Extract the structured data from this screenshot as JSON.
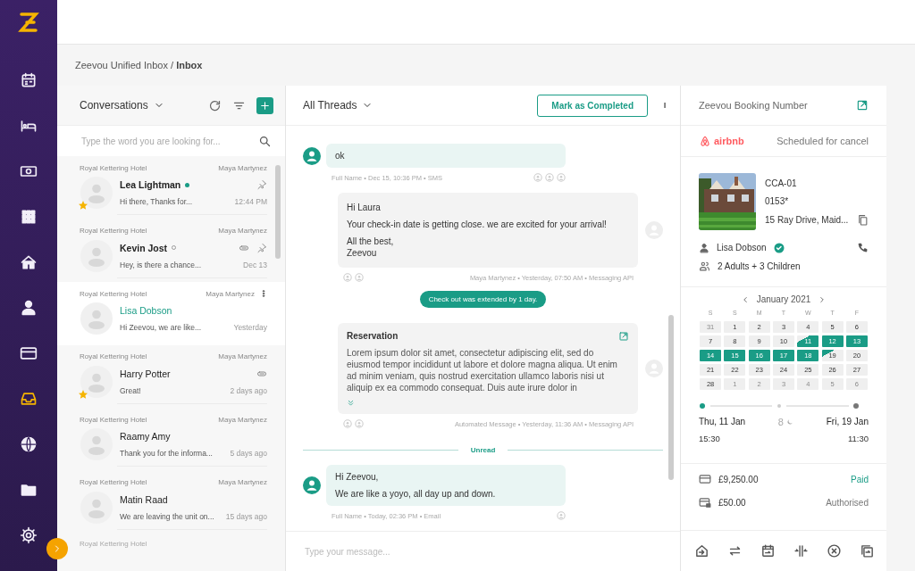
{
  "sidebar": {
    "items": [
      {
        "kind": "calendar",
        "selected": false
      },
      {
        "kind": "bed",
        "selected": false
      },
      {
        "kind": "money",
        "selected": false
      },
      {
        "kind": "grid",
        "selected": false
      },
      {
        "kind": "home",
        "selected": false
      },
      {
        "kind": "person",
        "selected": false
      },
      {
        "kind": "card",
        "selected": false
      },
      {
        "kind": "inbox",
        "selected": true
      },
      {
        "kind": "globe",
        "selected": false
      },
      {
        "kind": "folder",
        "selected": false
      },
      {
        "kind": "settings",
        "selected": false
      }
    ]
  },
  "breadcrumb": "Zeevou Unified Inbox / **Inbox**",
  "conversations": {
    "title": "Conversations",
    "search": {
      "placeholder": "Type the word you are looking for..."
    },
    "items": [
      {
        "property": "Royal Kettering Hotel",
        "agent": "Maya Martynez",
        "name": "Lea Lightman",
        "online": true,
        "unread": true,
        "starred": true,
        "pinned": true,
        "attachment": false,
        "preview": "Hi there, Thanks for...",
        "time": "12:44 PM",
        "selected": false
      },
      {
        "property": "Royal Kettering Hotel",
        "agent": "Maya Martynez",
        "name": "Kevin Jost",
        "online": false,
        "unread": true,
        "starred": false,
        "pinned": true,
        "attachment": true,
        "preview": "Hey, is there a chance...",
        "time": "Dec 13",
        "selected": false
      },
      {
        "property": "Royal Kettering Hotel",
        "agent": "Maya Martynez",
        "name": "Lisa Dobson",
        "unread": false,
        "starred": false,
        "pinned": false,
        "attachment": false,
        "preview": "Hi Zeevou, we are like...",
        "time": "Yesterday",
        "selected": true
      },
      {
        "property": "Royal Kettering Hotel",
        "agent": "Maya Martynez",
        "name": "Harry Potter",
        "unread": false,
        "starred": true,
        "pinned": false,
        "attachment": true,
        "preview": "Great!",
        "time": "2 days ago",
        "selected": false
      },
      {
        "property": "Royal Kettering Hotel",
        "agent": "Maya Martynez",
        "name": "Raamy Amy",
        "unread": false,
        "starred": false,
        "pinned": false,
        "attachment": false,
        "preview": "Thank you for the informa...",
        "time": "5 days ago",
        "selected": false
      },
      {
        "property": "Royal Kettering Hotel",
        "agent": "Maya Martynez",
        "name": "Matin Raad",
        "unread": false,
        "starred": false,
        "pinned": false,
        "attachment": false,
        "preview": "We are leaving the unit on...",
        "time": "15 days ago",
        "selected": false
      }
    ],
    "cut_off_property": "Royal Kettering Hotel"
  },
  "chat": {
    "filter": "All Threads",
    "complete_button": "Mark as Completed",
    "composer": {
      "placeholder": "Type your message..."
    },
    "messages": [
      {
        "kind": "incoming",
        "lines": [
          "ok"
        ],
        "meta": "Full Name • Dec 15, 10:36 PM • SMS",
        "read_by": [
          {
            "kind": "avatar"
          },
          {
            "kind": "avatar"
          },
          {
            "kind": "avatar"
          }
        ]
      },
      {
        "kind": "outgoing",
        "lines": [
          "Hi Laura",
          "Your check-in date is getting close. we are excited for your arrival!",
          "All the best,\nZeevou"
        ],
        "meta": "Maya Martynez • Yesterday, 07:50 AM • Messaging API",
        "read_by": [
          {
            "kind": "avatar"
          },
          {
            "kind": "avatar"
          }
        ]
      },
      {
        "kind": "event",
        "text": "Check out was extended by 1 day."
      },
      {
        "kind": "card",
        "title": "Reservation",
        "body": "Lorem ipsum dolor sit amet, consectetur adipiscing elit, sed do eiusmod tempor incididunt ut labore et dolore magna aliqua. Ut enim ad minim veniam, quis nostrud exercitation ullamco laboris nisi ut aliquip ex ea commodo consequat. Duis aute irure dolor in",
        "meta": "Automated Message • Yesterday, 11:36 AM • Messaging API",
        "read_by": [
          {
            "kind": "avatar"
          },
          {
            "kind": "avatar"
          }
        ]
      },
      {
        "kind": "divider",
        "text": "Unread"
      },
      {
        "kind": "incoming",
        "lines": [
          "Hi Zeevou,",
          "We are like a yoyo, all day up and down."
        ],
        "meta": "Full Name • Today, 02:36 PM • Email",
        "read_by": [
          {
            "kind": "avatar"
          }
        ]
      }
    ]
  },
  "booking": {
    "title": "Zeevou Booking Number",
    "channel": "airbnb",
    "status": "Scheduled for cancel",
    "unit": {
      "code": "CCA-01",
      "number": "0153*",
      "address": "15 Ray Drive, Maid..."
    },
    "guest": {
      "name": "Lisa Dobson",
      "verified": true,
      "party": "2 Adults + 3 Children"
    },
    "calendar": {
      "month": "January 2021",
      "weekdays": [
        "S",
        "S",
        "M",
        "T",
        "W",
        "T",
        "F"
      ],
      "days": [
        {
          "day": "31",
          "kind": "other"
        },
        {
          "day": "1",
          "kind": "normal"
        },
        {
          "day": "2",
          "kind": "normal"
        },
        {
          "day": "3",
          "kind": "normal"
        },
        {
          "day": "4",
          "kind": "normal"
        },
        {
          "day": "5",
          "kind": "normal"
        },
        {
          "day": "6",
          "kind": "normal"
        },
        {
          "day": "7",
          "kind": "normal"
        },
        {
          "day": "8",
          "kind": "normal"
        },
        {
          "day": "9",
          "kind": "normal"
        },
        {
          "day": "10",
          "kind": "normal"
        },
        {
          "day": "11",
          "kind": "checkin"
        },
        {
          "day": "12",
          "kind": "booked"
        },
        {
          "day": "13",
          "kind": "booked"
        },
        {
          "day": "14",
          "kind": "booked"
        },
        {
          "day": "15",
          "kind": "booked"
        },
        {
          "day": "16",
          "kind": "booked"
        },
        {
          "day": "17",
          "kind": "booked"
        },
        {
          "day": "18",
          "kind": "booked"
        },
        {
          "day": "19",
          "kind": "checkout"
        },
        {
          "day": "20",
          "kind": "normal"
        },
        {
          "day": "21",
          "kind": "normal"
        },
        {
          "day": "22",
          "kind": "normal"
        },
        {
          "day": "23",
          "kind": "normal"
        },
        {
          "day": "24",
          "kind": "normal"
        },
        {
          "day": "25",
          "kind": "normal"
        },
        {
          "day": "26",
          "kind": "normal"
        },
        {
          "day": "27",
          "kind": "normal"
        },
        {
          "day": "28",
          "kind": "normal"
        },
        {
          "day": "1",
          "kind": "other"
        },
        {
          "day": "2",
          "kind": "other"
        },
        {
          "day": "3",
          "kind": "other"
        },
        {
          "day": "4",
          "kind": "other"
        },
        {
          "day": "5",
          "kind": "other"
        },
        {
          "day": "6",
          "kind": "other"
        }
      ]
    },
    "stay": {
      "checkin_date": "Thu, 11 Jan",
      "checkin_time": "15:30",
      "nights": "8",
      "checkout_date": "Fri, 19 Jan",
      "checkout_time": "11:30"
    },
    "payments": [
      {
        "kind": "card",
        "amount": "£9,250.00",
        "status": "Paid",
        "color": "#1a9c86"
      },
      {
        "kind": "card-lock",
        "amount": "£50.00",
        "status": "Authorised",
        "color": "#777777"
      }
    ],
    "actions": [
      {
        "kind": "check-in"
      },
      {
        "kind": "swap"
      },
      {
        "kind": "calendar"
      },
      {
        "kind": "split"
      },
      {
        "kind": "cancel"
      },
      {
        "kind": "copy"
      }
    ]
  }
}
